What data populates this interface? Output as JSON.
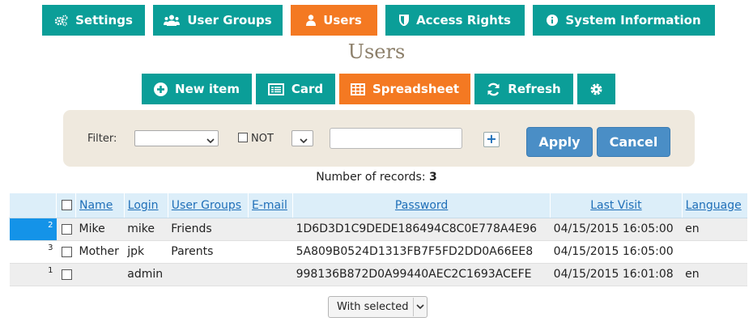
{
  "top_nav": {
    "settings": "Settings",
    "user_groups": "User Groups",
    "users": "Users",
    "access_rights": "Access Rights",
    "system_information": "System Information"
  },
  "page_title": "Users",
  "toolbar": {
    "new_item": "New item",
    "card": "Card",
    "spreadsheet": "Spreadsheet",
    "refresh": "Refresh"
  },
  "filter": {
    "label": "Filter:",
    "field_value": "",
    "not_label": "NOT",
    "condition_value": "",
    "text_value": "",
    "plus_label": "+",
    "apply_label": "Apply",
    "cancel_label": "Cancel"
  },
  "records": {
    "label": "Number of records:",
    "count": "3"
  },
  "table": {
    "columns": {
      "name": "Name",
      "login": "Login",
      "user_groups": "User Groups",
      "email": "E-mail",
      "password": "Password",
      "last_visit": "Last Visit",
      "language": "Language"
    },
    "rows": [
      {
        "num": "2",
        "name": "Mike",
        "login": "mike",
        "user_groups": "Friends",
        "email": "",
        "password": "1D6D3D1C9DEDE186494C8C0E778A4E96",
        "last_visit": "04/15/2015 16:05:00",
        "language": "en"
      },
      {
        "num": "3",
        "name": "Mother",
        "login": "jpk",
        "user_groups": "Parents",
        "email": "",
        "password": "5A809B0524D1313FB7F5FD2DD0A66EE8",
        "last_visit": "04/15/2015 16:05:00",
        "language": ""
      },
      {
        "num": "1",
        "name": "",
        "login": "admin",
        "user_groups": "",
        "email": "",
        "password": "998136B872D0A99440AEC2C1693ACEFE",
        "last_visit": "04/15/2015 16:01:08",
        "language": "en"
      }
    ]
  },
  "bulk_action": {
    "label": "With selected"
  },
  "colors": {
    "teal": "#0b9e98",
    "orange": "#f47922",
    "blue_button": "#4a8ec6",
    "selected_row": "#1493e8",
    "title": "#8c7f6a",
    "filter_panel": "#efe9de"
  }
}
